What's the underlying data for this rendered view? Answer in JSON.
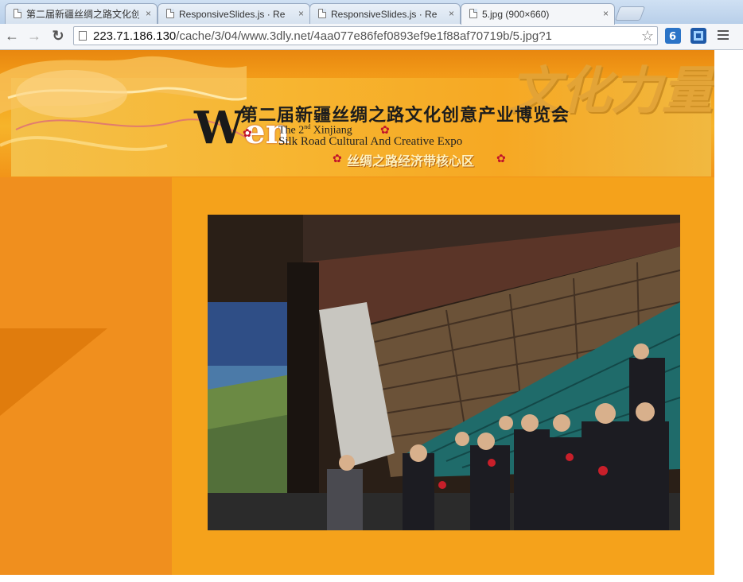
{
  "browser": {
    "tabs": [
      {
        "title": "第二届新疆丝绸之路文化创",
        "close": "×",
        "active": false
      },
      {
        "title": "ResponsiveSlides.js · Re",
        "close": "×",
        "active": false
      },
      {
        "title": "ResponsiveSlides.js · Re",
        "close": "×",
        "active": false
      },
      {
        "title": "5.jpg (900×660)",
        "close": "×",
        "active": true
      }
    ],
    "nav": {
      "back": "←",
      "forward": "→",
      "reload": "↻"
    },
    "url": {
      "host": "223.71.186.130",
      "path": "/cache/3/04/www.3dly.net/4aa077e86fef0893ef9e1f88af70719b/5.jpg?1"
    },
    "bookmark_star": "☆"
  },
  "banner": {
    "logo_w": "W",
    "logo_cn": "en",
    "title_cn": "第二届新疆丝绸之路文化创意产业博览会",
    "title_en_line1_pre": "The 2",
    "title_en_line1_sup": "nd",
    "title_en_line1_post": " Xinjiang",
    "title_en_line2": "Silk Road Cultural And Creative Expo",
    "subtitle_cn": "丝绸之路经济带核心区",
    "calligraphy": "文化力量"
  },
  "colors": {
    "page_bg": "#f5a21b",
    "left_panel": "#f08f1e",
    "tab_strip": "#b8cfe9"
  }
}
